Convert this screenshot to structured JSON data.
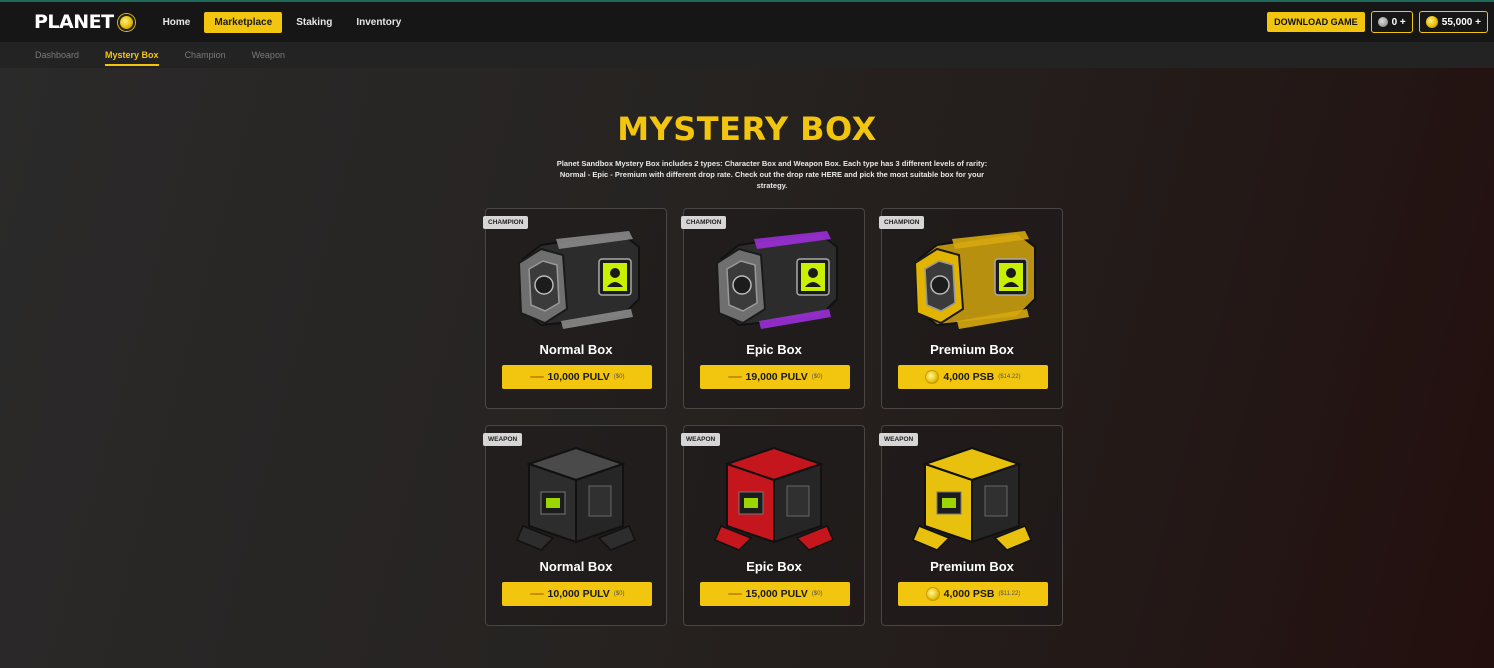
{
  "header": {
    "logo_text": "PLANET",
    "nav": [
      {
        "label": "Home",
        "active": false
      },
      {
        "label": "Marketplace",
        "active": true
      },
      {
        "label": "Staking",
        "active": false
      },
      {
        "label": "Inventory",
        "active": false
      }
    ],
    "download_label": "DOWNLOAD GAME",
    "wallet_gas": "0 +",
    "wallet_psb": "55,000 +"
  },
  "subnav": [
    {
      "label": "Dashboard",
      "active": false
    },
    {
      "label": "Mystery Box",
      "active": true
    },
    {
      "label": "Champion",
      "active": false
    },
    {
      "label": "Weapon",
      "active": false
    }
  ],
  "page": {
    "title": "MYSTERY BOX",
    "description": "Planet Sandbox Mystery Box includes 2 types: Character Box and Weapon Box. Each type has 3 different levels of rarity: Normal - Epic - Premium with different drop rate. Check out the drop rate HERE and pick the most suitable box for your strategy."
  },
  "boxes": [
    {
      "tag": "CHAMPION",
      "name": "Normal Box",
      "price": "10,000 PULV",
      "sub": "($0)",
      "currency_icon": "pulv-icon",
      "kind": "champion",
      "rarity": "normal",
      "accent": "#8a8a8a"
    },
    {
      "tag": "CHAMPION",
      "name": "Epic Box",
      "price": "19,000 PULV",
      "sub": "($0)",
      "currency_icon": "pulv-icon",
      "kind": "champion",
      "rarity": "epic",
      "accent": "#9b2fd8"
    },
    {
      "tag": "CHAMPION",
      "name": "Premium Box",
      "price": "4,000 PSB",
      "sub": "($14.22)",
      "currency_icon": "psb-coin-icon",
      "kind": "champion",
      "rarity": "premium",
      "accent": "#d6a90f"
    },
    {
      "tag": "WEAPON",
      "name": "Normal Box",
      "price": "10,000 PULV",
      "sub": "($0)",
      "currency_icon": "pulv-icon",
      "kind": "weapon",
      "rarity": "normal",
      "accent": "#3a3a3a"
    },
    {
      "tag": "WEAPON",
      "name": "Epic Box",
      "price": "15,000 PULV",
      "sub": "($0)",
      "currency_icon": "pulv-icon",
      "kind": "weapon",
      "rarity": "epic",
      "accent": "#c4161c"
    },
    {
      "tag": "WEAPON",
      "name": "Premium Box",
      "price": "4,000 PSB",
      "sub": "($11.22)",
      "currency_icon": "psb-coin-icon",
      "kind": "weapon",
      "rarity": "premium",
      "accent": "#e8c10e"
    }
  ],
  "colors": {
    "accent": "#f2c50f",
    "topbar": "#161616",
    "subbar": "#232323"
  }
}
